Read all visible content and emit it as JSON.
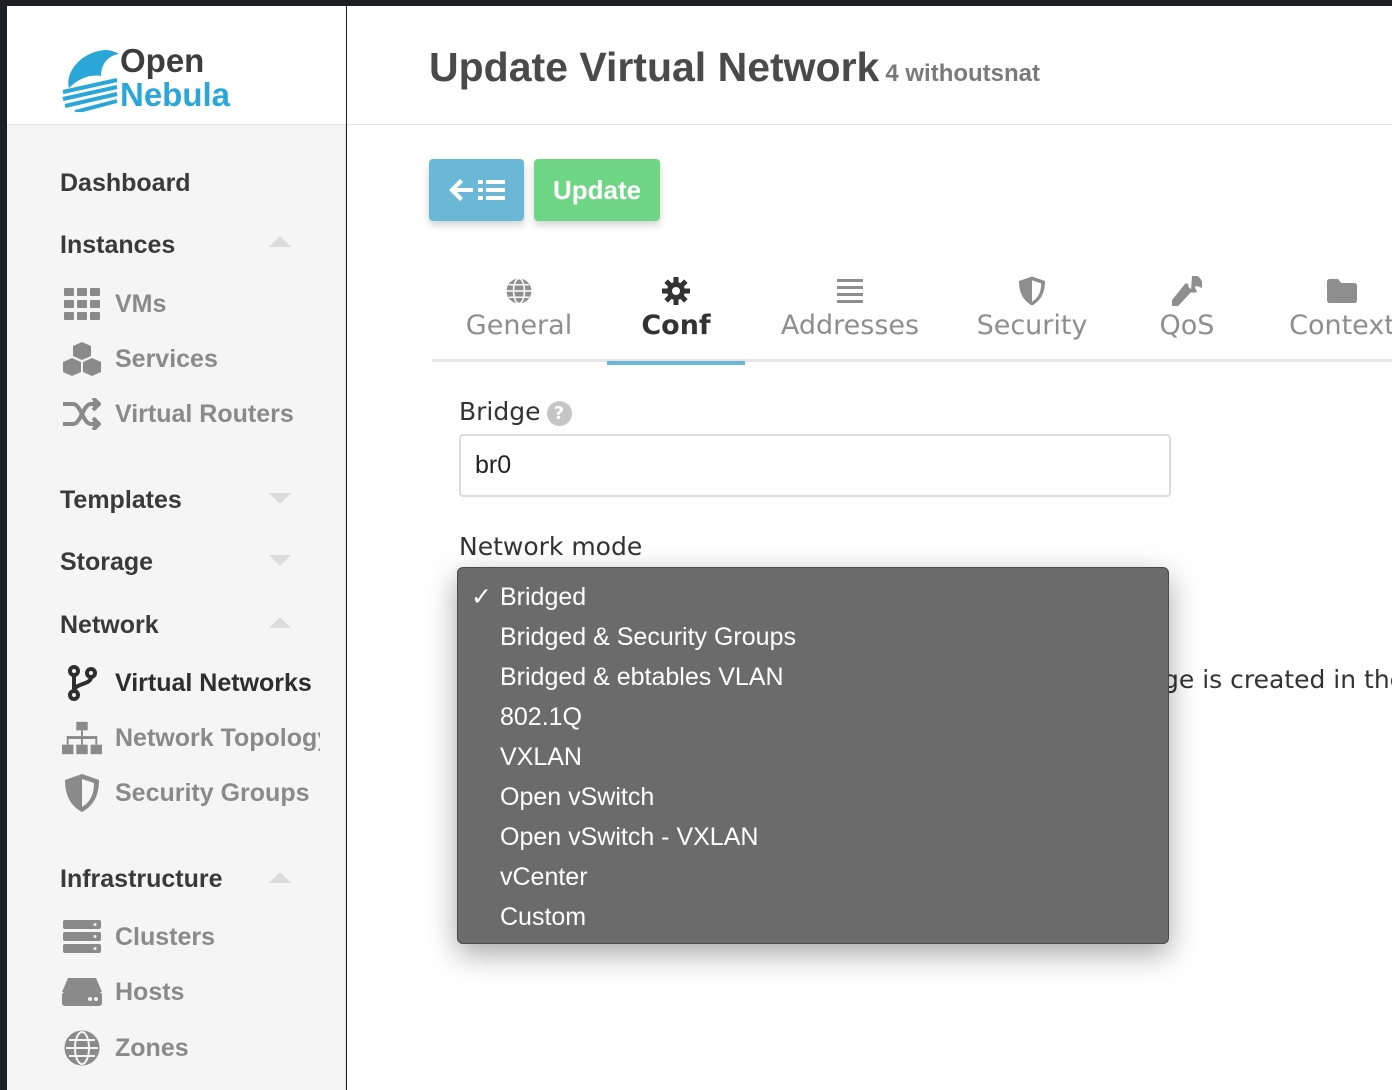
{
  "brand": {
    "line1": "Open",
    "line2": "Nebula"
  },
  "sidebar": {
    "dashboard": "Dashboard",
    "instances": {
      "label": "Instances",
      "items": [
        {
          "label": "VMs",
          "icon": "grid-icon"
        },
        {
          "label": "Services",
          "icon": "cubes-icon"
        },
        {
          "label": "Virtual Routers",
          "icon": "random-icon"
        }
      ]
    },
    "templates": "Templates",
    "storage": "Storage",
    "network": {
      "label": "Network",
      "items": [
        {
          "label": "Virtual Networks",
          "icon": "code-branch-icon",
          "active": true
        },
        {
          "label": "Network Topology",
          "icon": "sitemap-icon"
        },
        {
          "label": "Security Groups",
          "icon": "shield-icon"
        }
      ]
    },
    "infrastructure": {
      "label": "Infrastructure",
      "items": [
        {
          "label": "Clusters",
          "icon": "server-icon"
        },
        {
          "label": "Hosts",
          "icon": "hdd-icon"
        },
        {
          "label": "Zones",
          "icon": "globe-icon"
        }
      ]
    }
  },
  "header": {
    "title": "Update Virtual Network",
    "subtitle": "4 withoutsnat"
  },
  "toolbar": {
    "update_label": "Update"
  },
  "tabs": [
    {
      "label": "General",
      "icon": "globe-icon"
    },
    {
      "label": "Conf",
      "icon": "gear-icon",
      "active": true
    },
    {
      "label": "Addresses",
      "icon": "list-icon"
    },
    {
      "label": "Security",
      "icon": "shield-icon"
    },
    {
      "label": "QoS",
      "icon": "wrench-icon"
    },
    {
      "label": "Context",
      "icon": "folder-icon"
    }
  ],
  "form": {
    "bridge_label": "Bridge",
    "bridge_value": "br0",
    "network_mode_label": "Network mode",
    "description_fragment": "ge is created in the n"
  },
  "dropdown": {
    "selected": "Bridged",
    "options": [
      "Bridged",
      "Bridged & Security Groups",
      "Bridged & ebtables VLAN",
      "802.1Q",
      "VXLAN",
      "Open vSwitch",
      "Open vSwitch - VXLAN",
      "vCenter",
      "Custom"
    ]
  },
  "colors": {
    "accent": "#6ab8d6",
    "update_button": "#6fd686",
    "dropdown_bg": "#6b6b6b",
    "brand_blue": "#2aa6d8"
  }
}
